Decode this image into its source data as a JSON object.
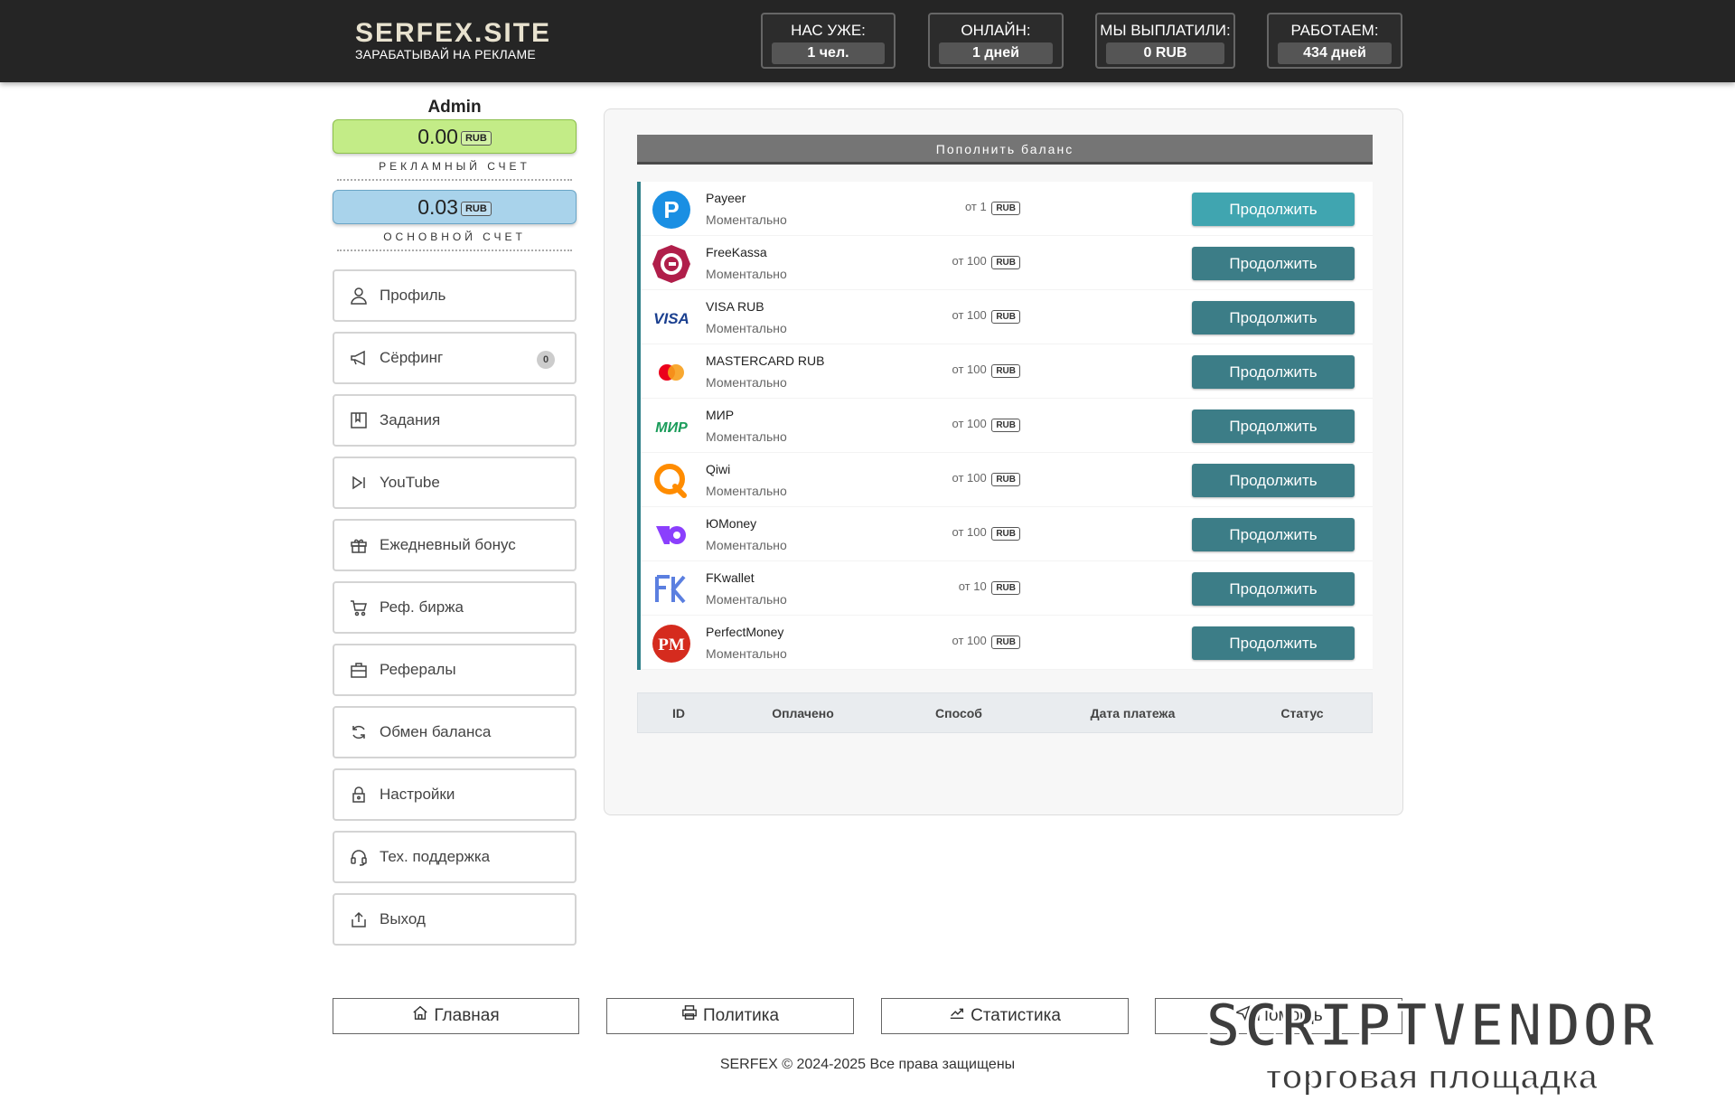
{
  "header": {
    "brand": "SERFEX.SITE",
    "slogan": "ЗАРАБАТЫВАЙ НА РЕКЛАМЕ",
    "stats": [
      {
        "label": "НАС УЖЕ:",
        "value": "1 чел."
      },
      {
        "label": "ОНЛАЙН:",
        "value": "1 дней"
      },
      {
        "label": "МЫ ВЫПЛАТИЛИ:",
        "value": "0 RUB"
      },
      {
        "label": "РАБОТАЕМ:",
        "value": "434 дней"
      }
    ]
  },
  "sidebar": {
    "username": "Admin",
    "ad_balance": "0.00",
    "ad_currency": "RUB",
    "ad_label": "РЕКЛАМНЫЙ СЧЕТ",
    "main_balance": "0.03",
    "main_currency": "RUB",
    "main_label": "ОСНОВНОЙ СЧЕТ",
    "menu": [
      {
        "label": "Профиль",
        "icon": "user-icon"
      },
      {
        "label": "Сёрфинг",
        "icon": "megaphone-icon",
        "count": "0"
      },
      {
        "label": "Задания",
        "icon": "bookmark-icon"
      },
      {
        "label": "YouTube",
        "icon": "play-icon"
      },
      {
        "label": "Ежедневный бонус",
        "icon": "gift-icon"
      },
      {
        "label": "Реф. биржа",
        "icon": "cart-icon"
      },
      {
        "label": "Рефералы",
        "icon": "briefcase-icon"
      },
      {
        "label": "Обмен баланса",
        "icon": "refresh-icon"
      },
      {
        "label": "Настройки",
        "icon": "lock-icon"
      },
      {
        "label": "Тех. поддержка",
        "icon": "headset-icon"
      },
      {
        "label": "Выход",
        "icon": "logout-icon"
      }
    ]
  },
  "main": {
    "title": "Пополнить баланс",
    "methods": [
      {
        "name": "Payeer",
        "speed": "Моментально",
        "min": "от 1",
        "currency": "RUB",
        "button": "Продолжить",
        "icon": "payeer-icon"
      },
      {
        "name": "FreeKassa",
        "speed": "Моментально",
        "min": "от 100",
        "currency": "RUB",
        "button": "Продолжить",
        "icon": "freekassa-icon"
      },
      {
        "name": "VISA RUB",
        "speed": "Моментально",
        "min": "от 100",
        "currency": "RUB",
        "button": "Продолжить",
        "icon": "visa-icon"
      },
      {
        "name": "MASTERCARD RUB",
        "speed": "Моментально",
        "min": "от 100",
        "currency": "RUB",
        "button": "Продолжить",
        "icon": "mastercard-icon"
      },
      {
        "name": "МИР",
        "speed": "Моментально",
        "min": "от 100",
        "currency": "RUB",
        "button": "Продолжить",
        "icon": "mir-icon"
      },
      {
        "name": "Qiwi",
        "speed": "Моментально",
        "min": "от 100",
        "currency": "RUB",
        "button": "Продолжить",
        "icon": "qiwi-icon"
      },
      {
        "name": "ЮMoney",
        "speed": "Моментально",
        "min": "от 100",
        "currency": "RUB",
        "button": "Продолжить",
        "icon": "yoomoney-icon"
      },
      {
        "name": "FKwallet",
        "speed": "Моментально",
        "min": "от 10",
        "currency": "RUB",
        "button": "Продолжить",
        "icon": "fkwallet-icon"
      },
      {
        "name": "PerfectMoney",
        "speed": "Моментально",
        "min": "от 100",
        "currency": "RUB",
        "button": "Продолжить",
        "icon": "perfectmoney-icon"
      }
    ],
    "table_headers": [
      "ID",
      "Оплачено",
      "Способ",
      "Дата платежа",
      "Статус"
    ]
  },
  "footer": {
    "links": [
      {
        "label": "Главная",
        "icon": "home-icon"
      },
      {
        "label": "Политика",
        "icon": "printer-icon"
      },
      {
        "label": "Статистика",
        "icon": "chart-icon"
      },
      {
        "label": "Помощь",
        "icon": "send-icon"
      }
    ],
    "copyright": "SERFEX © 2024-2025 Все права защищены"
  },
  "watermark": {
    "line1": "SCRIPTVENDOR",
    "line2": "торговая площадка"
  }
}
